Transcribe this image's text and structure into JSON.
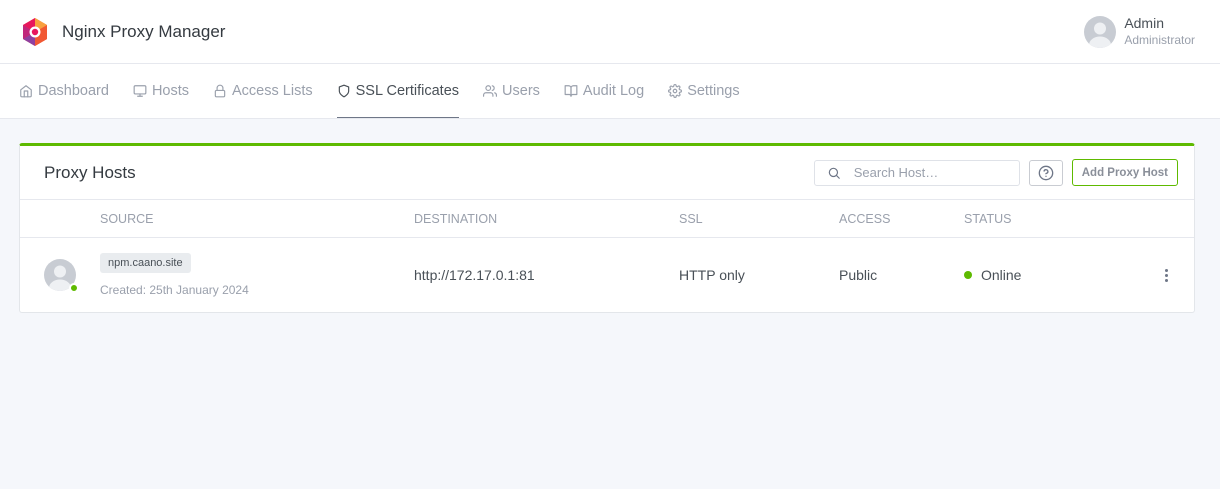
{
  "app": {
    "title": "Nginx Proxy Manager"
  },
  "user": {
    "name": "Admin",
    "role": "Administrator"
  },
  "nav": {
    "items": [
      {
        "label": "Dashboard",
        "icon": "home-icon"
      },
      {
        "label": "Hosts",
        "icon": "monitor-icon"
      },
      {
        "label": "Access Lists",
        "icon": "lock-icon"
      },
      {
        "label": "SSL Certificates",
        "icon": "shield-icon",
        "active": true
      },
      {
        "label": "Users",
        "icon": "users-icon"
      },
      {
        "label": "Audit Log",
        "icon": "book-icon"
      },
      {
        "label": "Settings",
        "icon": "gear-icon"
      }
    ]
  },
  "card": {
    "title": "Proxy Hosts",
    "search_placeholder": "Search Host…",
    "help_icon": "help-circle-icon",
    "add_button": "Add Proxy Host",
    "accent_color": "#5eba00"
  },
  "table": {
    "columns": [
      "SOURCE",
      "DESTINATION",
      "SSL",
      "ACCESS",
      "STATUS"
    ],
    "rows": [
      {
        "source": "npm.caano.site",
        "created": "Created: 25th January 2024",
        "destination": "http://172.17.0.1:81",
        "ssl": "HTTP only",
        "access": "Public",
        "status": "Online"
      }
    ]
  }
}
